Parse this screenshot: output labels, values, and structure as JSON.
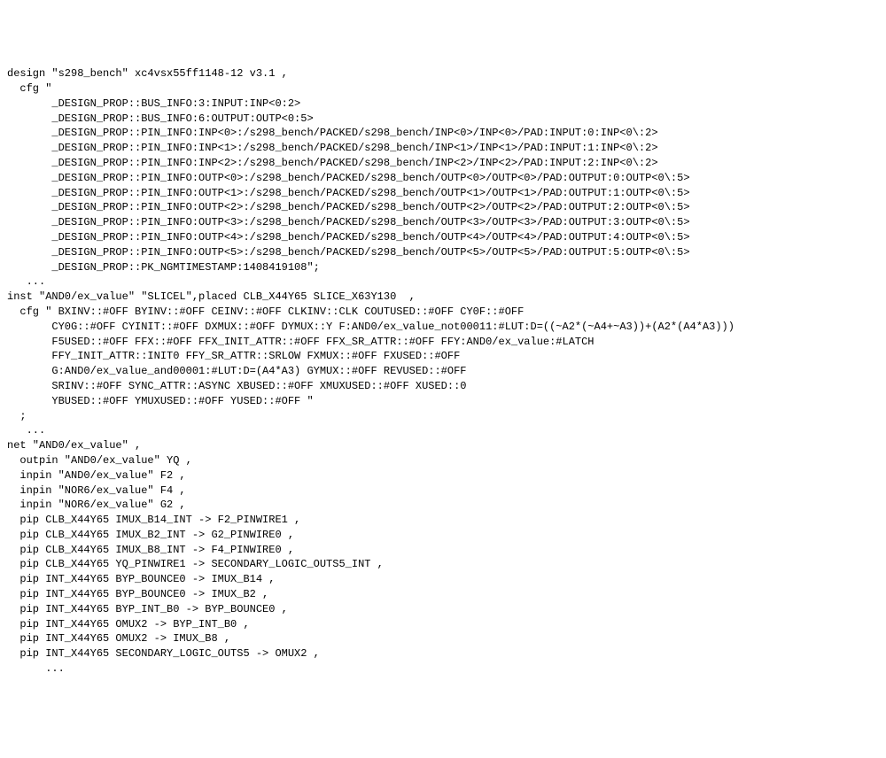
{
  "lines": [
    "design \"s298_bench\" xc4vsx55ff1148-12 v3.1 ,",
    "  cfg \"",
    "       _DESIGN_PROP::BUS_INFO:3:INPUT:INP<0:2>",
    "       _DESIGN_PROP::BUS_INFO:6:OUTPUT:OUTP<0:5>",
    "       _DESIGN_PROP::PIN_INFO:INP<0>:/s298_bench/PACKED/s298_bench/INP<0>/INP<0>/PAD:INPUT:0:INP<0\\:2>",
    "       _DESIGN_PROP::PIN_INFO:INP<1>:/s298_bench/PACKED/s298_bench/INP<1>/INP<1>/PAD:INPUT:1:INP<0\\:2>",
    "       _DESIGN_PROP::PIN_INFO:INP<2>:/s298_bench/PACKED/s298_bench/INP<2>/INP<2>/PAD:INPUT:2:INP<0\\:2>",
    "       _DESIGN_PROP::PIN_INFO:OUTP<0>:/s298_bench/PACKED/s298_bench/OUTP<0>/OUTP<0>/PAD:OUTPUT:0:OUTP<0\\:5>",
    "       _DESIGN_PROP::PIN_INFO:OUTP<1>:/s298_bench/PACKED/s298_bench/OUTP<1>/OUTP<1>/PAD:OUTPUT:1:OUTP<0\\:5>",
    "       _DESIGN_PROP::PIN_INFO:OUTP<2>:/s298_bench/PACKED/s298_bench/OUTP<2>/OUTP<2>/PAD:OUTPUT:2:OUTP<0\\:5>",
    "       _DESIGN_PROP::PIN_INFO:OUTP<3>:/s298_bench/PACKED/s298_bench/OUTP<3>/OUTP<3>/PAD:OUTPUT:3:OUTP<0\\:5>",
    "       _DESIGN_PROP::PIN_INFO:OUTP<4>:/s298_bench/PACKED/s298_bench/OUTP<4>/OUTP<4>/PAD:OUTPUT:4:OUTP<0\\:5>",
    "       _DESIGN_PROP::PIN_INFO:OUTP<5>:/s298_bench/PACKED/s298_bench/OUTP<5>/OUTP<5>/PAD:OUTPUT:5:OUTP<0\\:5>",
    "       _DESIGN_PROP::PK_NGMTIMESTAMP:1408419108\";",
    "   ...",
    "",
    "inst \"AND0/ex_value\" \"SLICEL\",placed CLB_X44Y65 SLICE_X63Y130  ,",
    "  cfg \" BXINV::#OFF BYINV::#OFF CEINV::#OFF CLKINV::CLK COUTUSED::#OFF CY0F::#OFF",
    "       CY0G::#OFF CYINIT::#OFF DXMUX::#OFF DYMUX::Y F:AND0/ex_value_not00011:#LUT:D=((~A2*(~A4+~A3))+(A2*(A4*A3)))",
    "       F5USED::#OFF FFX::#OFF FFX_INIT_ATTR::#OFF FFX_SR_ATTR::#OFF FFY:AND0/ex_value:#LATCH",
    "       FFY_INIT_ATTR::INIT0 FFY_SR_ATTR::SRLOW FXMUX::#OFF FXUSED::#OFF",
    "       G:AND0/ex_value_and00001:#LUT:D=(A4*A3) GYMUX::#OFF REVUSED::#OFF",
    "       SRINV::#OFF SYNC_ATTR::ASYNC XBUSED::#OFF XMUXUSED::#OFF XUSED::0",
    "       YBUSED::#OFF YMUXUSED::#OFF YUSED::#OFF \"",
    "  ;",
    "   ...",
    "",
    "net \"AND0/ex_value\" ,",
    "  outpin \"AND0/ex_value\" YQ ,",
    "  inpin \"AND0/ex_value\" F2 ,",
    "  inpin \"NOR6/ex_value\" F4 ,",
    "  inpin \"NOR6/ex_value\" G2 ,",
    "  pip CLB_X44Y65 IMUX_B14_INT -> F2_PINWIRE1 ,",
    "  pip CLB_X44Y65 IMUX_B2_INT -> G2_PINWIRE0 ,",
    "  pip CLB_X44Y65 IMUX_B8_INT -> F4_PINWIRE0 ,",
    "  pip CLB_X44Y65 YQ_PINWIRE1 -> SECONDARY_LOGIC_OUTS5_INT ,",
    "  pip INT_X44Y65 BYP_BOUNCE0 -> IMUX_B14 ,",
    "  pip INT_X44Y65 BYP_BOUNCE0 -> IMUX_B2 ,",
    "  pip INT_X44Y65 BYP_INT_B0 -> BYP_BOUNCE0 ,",
    "  pip INT_X44Y65 OMUX2 -> BYP_INT_B0 ,",
    "  pip INT_X44Y65 OMUX2 -> IMUX_B8 ,",
    "  pip INT_X44Y65 SECONDARY_LOGIC_OUTS5 -> OMUX2 ,",
    "",
    "      ..."
  ]
}
